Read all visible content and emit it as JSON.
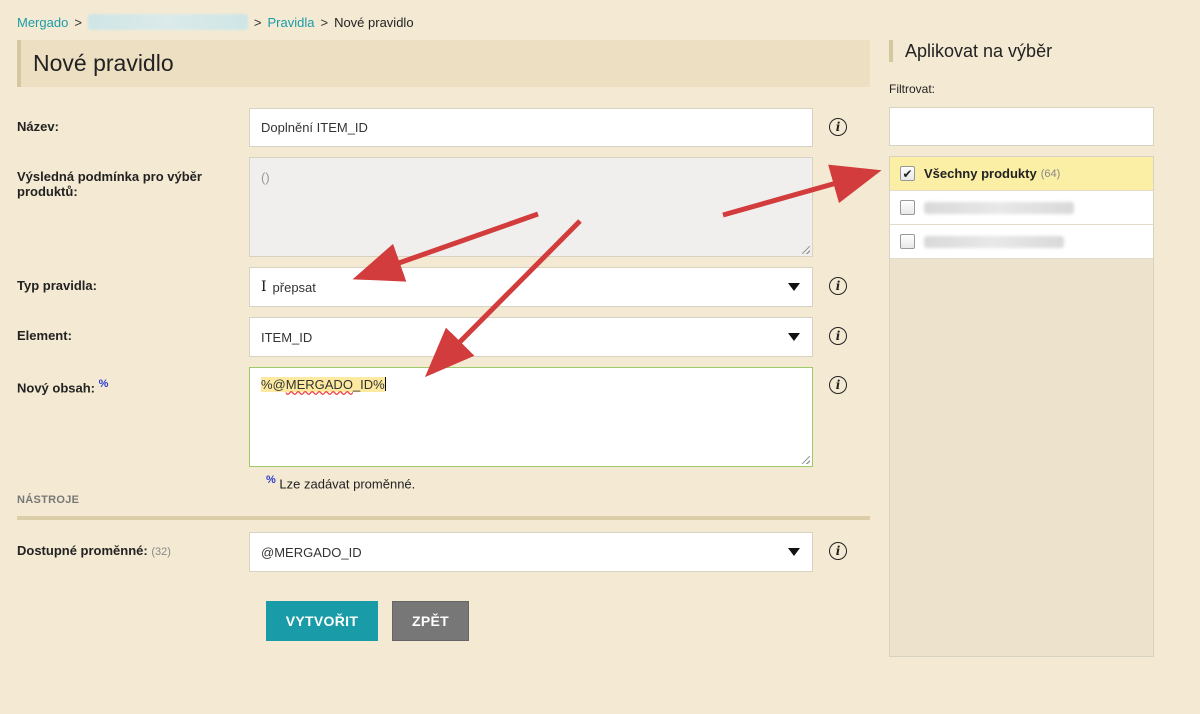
{
  "breadcrumb": {
    "root": "Mergado",
    "sep": ">",
    "section": "Pravidla",
    "current": "Nové pravidlo"
  },
  "page": {
    "title": "Nové pravidlo"
  },
  "form": {
    "name": {
      "label": "Název:",
      "value": "Doplnění ITEM_ID"
    },
    "condition": {
      "label": "Výsledná podmínka pro výběr produktů:",
      "value": "()"
    },
    "rule_type": {
      "label": "Typ pravidla:",
      "value": "přepsat"
    },
    "element": {
      "label": "Element:",
      "value": "ITEM_ID"
    },
    "new_content": {
      "label": "Nový obsah:",
      "pct": "%",
      "value_prefix": "%@",
      "value_word": "MERGADO",
      "value_suffix": "_ID%"
    },
    "hint": {
      "pct": "%",
      "text": "Lze zadávat proměnné."
    },
    "tools_label": "NÁSTROJE",
    "variables": {
      "label": "Dostupné proměnné:",
      "count": "(32)",
      "value": "@MERGADO_ID"
    },
    "create_button": "VYTVOŘIT",
    "back_button": "ZPĚT"
  },
  "panel": {
    "title": "Aplikovat na výběr",
    "filter_label": "Filtrovat:",
    "filter_value": "",
    "items": [
      {
        "label": "Všechny produkty",
        "count": "(64)",
        "checked": true
      }
    ]
  },
  "icons": {
    "info": "info-icon",
    "checkbox": "checkbox-icon",
    "dropdown": "chevron-down-icon",
    "arrow": "annotation-arrow"
  },
  "colors": {
    "accent": "#1a9ca8",
    "background": "#f4ead3",
    "arrow": "#d23c3c",
    "selected": "#fbeea5"
  }
}
